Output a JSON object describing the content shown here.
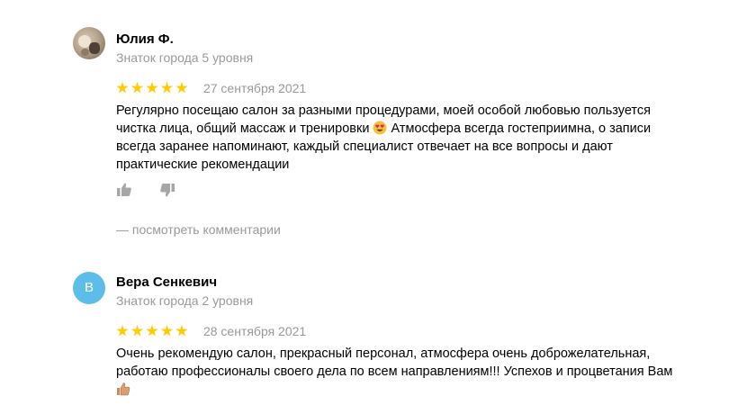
{
  "reviews": [
    {
      "author_name": "Юлия Ф.",
      "author_level": "Знаток города 5 уровня",
      "rating": 5,
      "date": "27 сентября 2021",
      "text_parts": [
        "Регулярно посещаю салон за разными процедурами, моей особой любовью пользуется чистка лица, общий массаж и тренировки ",
        " Атмосфера всегда гостеприимна, о записи всегда заранее напоминают, каждый специалист отвечает на все вопросы и дают практические рекомендации"
      ],
      "emoji": "heart-eyes-emoji",
      "comments_link": "— посмотреть комментарии"
    },
    {
      "author_name": "Вера Сенкевич",
      "avatar_letter": "В",
      "author_level": "Знаток города 2 уровня",
      "rating": 5,
      "date": "28 сентября 2021",
      "text_parts": [
        "Очень рекомендую салон, прекрасный персонал, атмосфера очень доброжелательная, работаю профессионалы своего дела по всем направлениям!!! Успехов и процветания Вам "
      ],
      "emoji": "thumbs-up-emoji"
    }
  ],
  "colors": {
    "star": "#ffcc00",
    "muted_text": "#999999",
    "avatar_letter_bg": "#5bbde8"
  }
}
